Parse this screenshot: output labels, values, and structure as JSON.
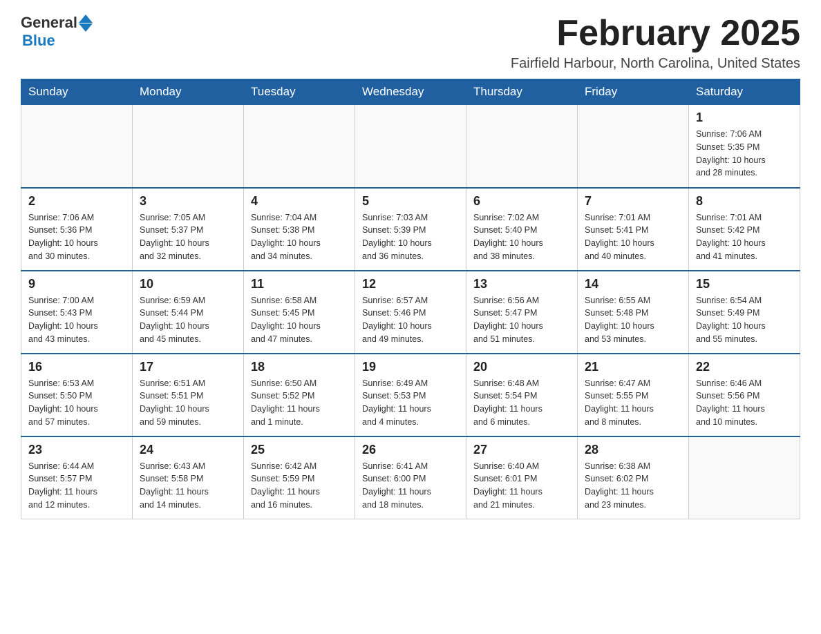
{
  "header": {
    "logo": {
      "general": "General",
      "blue": "Blue"
    },
    "title": "February 2025",
    "location": "Fairfield Harbour, North Carolina, United States"
  },
  "days_of_week": [
    "Sunday",
    "Monday",
    "Tuesday",
    "Wednesday",
    "Thursday",
    "Friday",
    "Saturday"
  ],
  "weeks": [
    {
      "days": [
        {
          "date": "",
          "info": ""
        },
        {
          "date": "",
          "info": ""
        },
        {
          "date": "",
          "info": ""
        },
        {
          "date": "",
          "info": ""
        },
        {
          "date": "",
          "info": ""
        },
        {
          "date": "",
          "info": ""
        },
        {
          "date": "1",
          "info": "Sunrise: 7:06 AM\nSunset: 5:35 PM\nDaylight: 10 hours\nand 28 minutes."
        }
      ]
    },
    {
      "days": [
        {
          "date": "2",
          "info": "Sunrise: 7:06 AM\nSunset: 5:36 PM\nDaylight: 10 hours\nand 30 minutes."
        },
        {
          "date": "3",
          "info": "Sunrise: 7:05 AM\nSunset: 5:37 PM\nDaylight: 10 hours\nand 32 minutes."
        },
        {
          "date": "4",
          "info": "Sunrise: 7:04 AM\nSunset: 5:38 PM\nDaylight: 10 hours\nand 34 minutes."
        },
        {
          "date": "5",
          "info": "Sunrise: 7:03 AM\nSunset: 5:39 PM\nDaylight: 10 hours\nand 36 minutes."
        },
        {
          "date": "6",
          "info": "Sunrise: 7:02 AM\nSunset: 5:40 PM\nDaylight: 10 hours\nand 38 minutes."
        },
        {
          "date": "7",
          "info": "Sunrise: 7:01 AM\nSunset: 5:41 PM\nDaylight: 10 hours\nand 40 minutes."
        },
        {
          "date": "8",
          "info": "Sunrise: 7:01 AM\nSunset: 5:42 PM\nDaylight: 10 hours\nand 41 minutes."
        }
      ]
    },
    {
      "days": [
        {
          "date": "9",
          "info": "Sunrise: 7:00 AM\nSunset: 5:43 PM\nDaylight: 10 hours\nand 43 minutes."
        },
        {
          "date": "10",
          "info": "Sunrise: 6:59 AM\nSunset: 5:44 PM\nDaylight: 10 hours\nand 45 minutes."
        },
        {
          "date": "11",
          "info": "Sunrise: 6:58 AM\nSunset: 5:45 PM\nDaylight: 10 hours\nand 47 minutes."
        },
        {
          "date": "12",
          "info": "Sunrise: 6:57 AM\nSunset: 5:46 PM\nDaylight: 10 hours\nand 49 minutes."
        },
        {
          "date": "13",
          "info": "Sunrise: 6:56 AM\nSunset: 5:47 PM\nDaylight: 10 hours\nand 51 minutes."
        },
        {
          "date": "14",
          "info": "Sunrise: 6:55 AM\nSunset: 5:48 PM\nDaylight: 10 hours\nand 53 minutes."
        },
        {
          "date": "15",
          "info": "Sunrise: 6:54 AM\nSunset: 5:49 PM\nDaylight: 10 hours\nand 55 minutes."
        }
      ]
    },
    {
      "days": [
        {
          "date": "16",
          "info": "Sunrise: 6:53 AM\nSunset: 5:50 PM\nDaylight: 10 hours\nand 57 minutes."
        },
        {
          "date": "17",
          "info": "Sunrise: 6:51 AM\nSunset: 5:51 PM\nDaylight: 10 hours\nand 59 minutes."
        },
        {
          "date": "18",
          "info": "Sunrise: 6:50 AM\nSunset: 5:52 PM\nDaylight: 11 hours\nand 1 minute."
        },
        {
          "date": "19",
          "info": "Sunrise: 6:49 AM\nSunset: 5:53 PM\nDaylight: 11 hours\nand 4 minutes."
        },
        {
          "date": "20",
          "info": "Sunrise: 6:48 AM\nSunset: 5:54 PM\nDaylight: 11 hours\nand 6 minutes."
        },
        {
          "date": "21",
          "info": "Sunrise: 6:47 AM\nSunset: 5:55 PM\nDaylight: 11 hours\nand 8 minutes."
        },
        {
          "date": "22",
          "info": "Sunrise: 6:46 AM\nSunset: 5:56 PM\nDaylight: 11 hours\nand 10 minutes."
        }
      ]
    },
    {
      "days": [
        {
          "date": "23",
          "info": "Sunrise: 6:44 AM\nSunset: 5:57 PM\nDaylight: 11 hours\nand 12 minutes."
        },
        {
          "date": "24",
          "info": "Sunrise: 6:43 AM\nSunset: 5:58 PM\nDaylight: 11 hours\nand 14 minutes."
        },
        {
          "date": "25",
          "info": "Sunrise: 6:42 AM\nSunset: 5:59 PM\nDaylight: 11 hours\nand 16 minutes."
        },
        {
          "date": "26",
          "info": "Sunrise: 6:41 AM\nSunset: 6:00 PM\nDaylight: 11 hours\nand 18 minutes."
        },
        {
          "date": "27",
          "info": "Sunrise: 6:40 AM\nSunset: 6:01 PM\nDaylight: 11 hours\nand 21 minutes."
        },
        {
          "date": "28",
          "info": "Sunrise: 6:38 AM\nSunset: 6:02 PM\nDaylight: 11 hours\nand 23 minutes."
        },
        {
          "date": "",
          "info": ""
        }
      ]
    }
  ]
}
